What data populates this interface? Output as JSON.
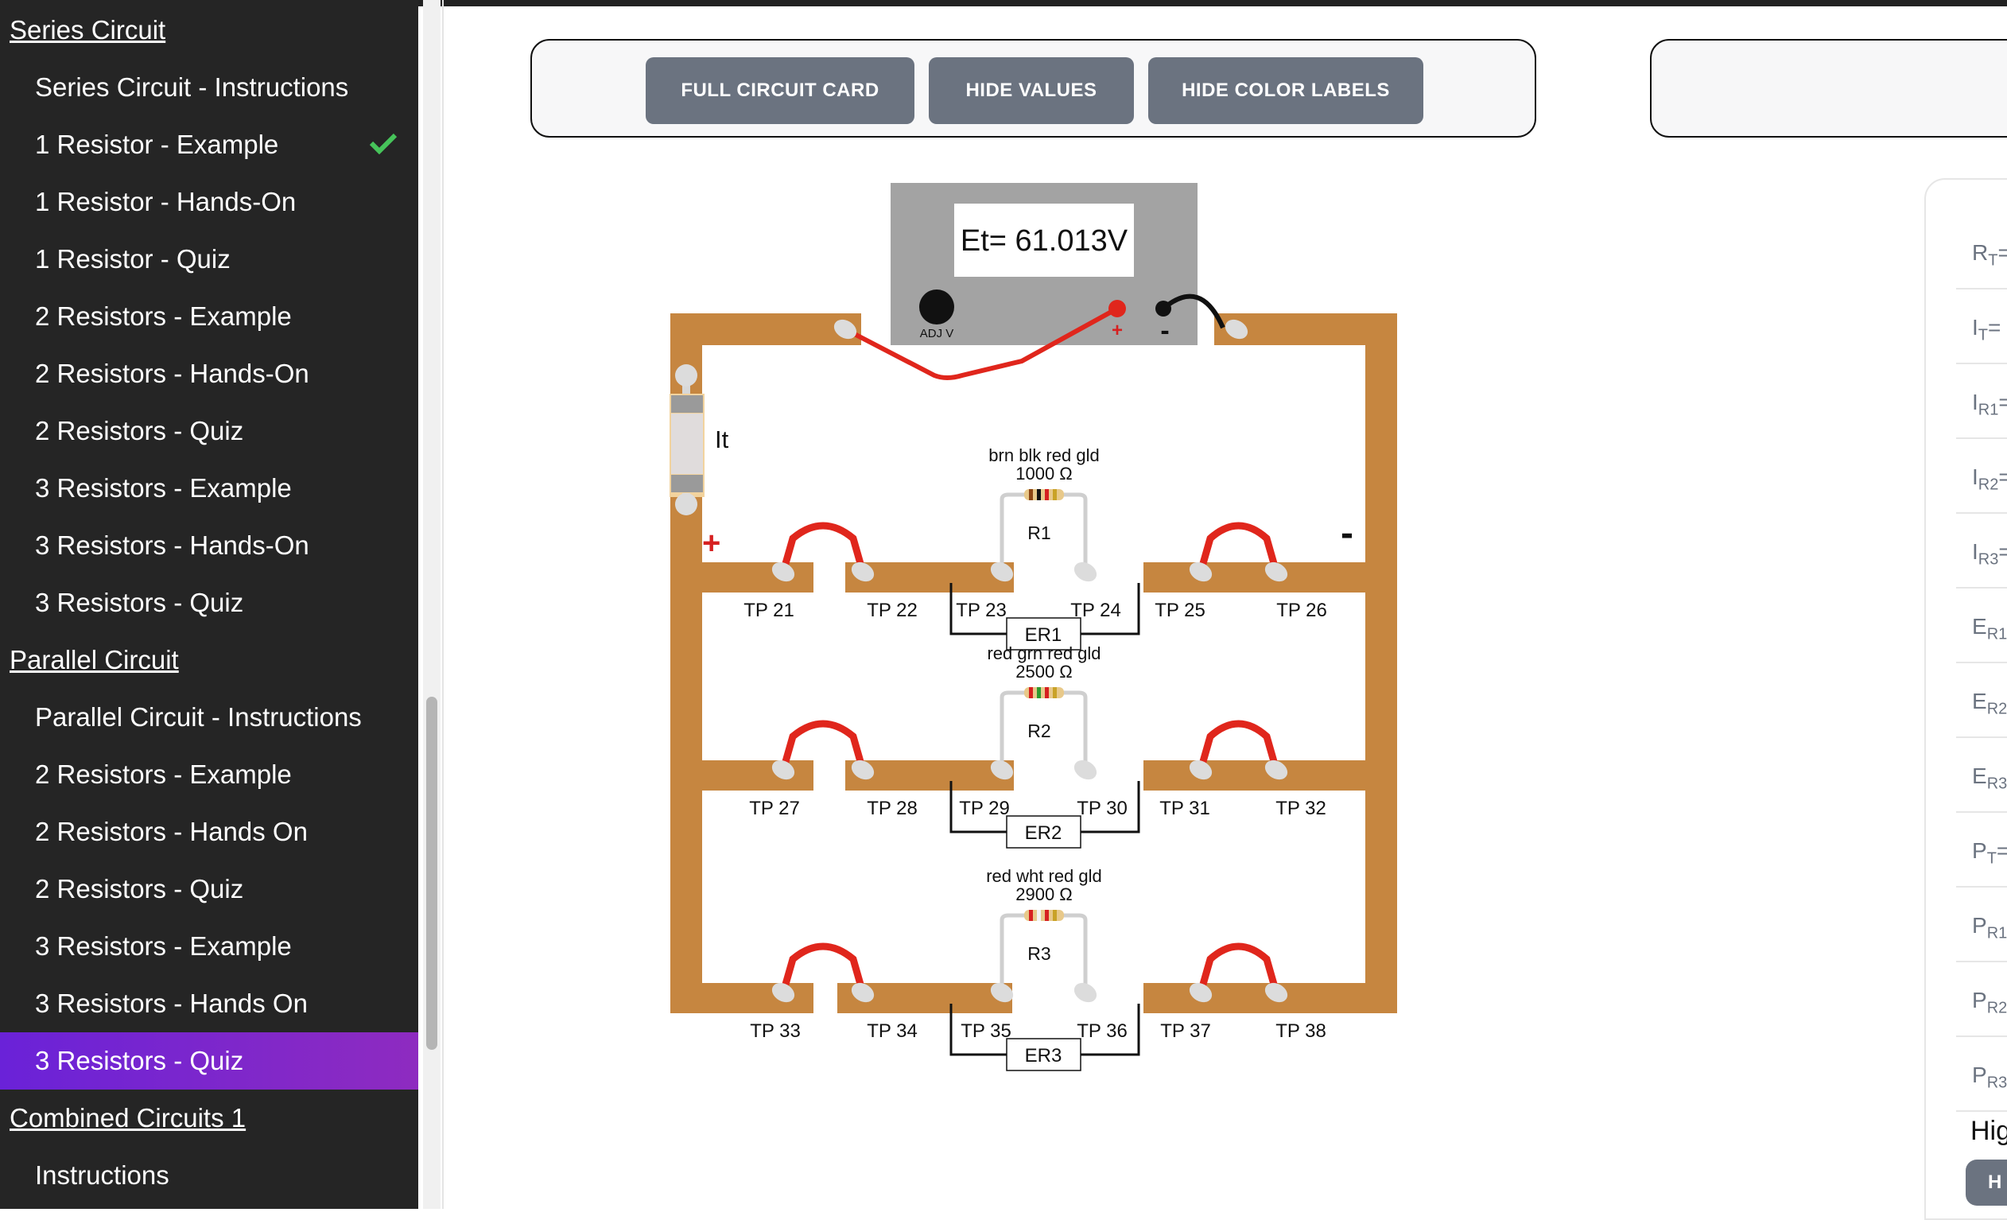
{
  "sidebar": {
    "rows": [
      {
        "type": "section",
        "label": "Series Circuit"
      },
      {
        "type": "item",
        "label": "Series Circuit - Instructions"
      },
      {
        "type": "item",
        "label": "1 Resistor - Example",
        "completed": true
      },
      {
        "type": "item",
        "label": "1 Resistor - Hands-On"
      },
      {
        "type": "item",
        "label": "1 Resistor - Quiz"
      },
      {
        "type": "item",
        "label": "2 Resistors - Example"
      },
      {
        "type": "item",
        "label": "2 Resistors - Hands-On"
      },
      {
        "type": "item",
        "label": "2 Resistors - Quiz"
      },
      {
        "type": "item",
        "label": "3 Resistors - Example"
      },
      {
        "type": "item",
        "label": "3 Resistors - Hands-On"
      },
      {
        "type": "item",
        "label": "3 Resistors - Quiz"
      },
      {
        "type": "section",
        "label": "Parallel Circuit"
      },
      {
        "type": "item",
        "label": "Parallel Circuit - Instructions"
      },
      {
        "type": "item",
        "label": "2 Resistors - Example"
      },
      {
        "type": "item",
        "label": "2 Resistors - Hands On"
      },
      {
        "type": "item",
        "label": "2 Resistors - Quiz"
      },
      {
        "type": "item",
        "label": "3 Resistors - Example"
      },
      {
        "type": "item",
        "label": "3 Resistors - Hands On"
      },
      {
        "type": "item",
        "label": "3 Resistors - Quiz",
        "active": true
      },
      {
        "type": "section",
        "label": "Combined Circuits 1"
      },
      {
        "type": "item",
        "label": "Instructions"
      }
    ]
  },
  "toolbar": {
    "full_circuit_card": "FULL CIRCUIT CARD",
    "hide_values": "HIDE VALUES",
    "hide_color_labels": "HIDE COLOR LABELS"
  },
  "supply": {
    "display": "Et= 61.013V",
    "adj_label": "ADJ V",
    "plus": "+",
    "minus": "-"
  },
  "meter_label": "It",
  "rail_plus": "+",
  "rail_minus": "-",
  "branches": [
    {
      "name": "R1",
      "colors": "brn blk red gld",
      "value": "1000 Ω",
      "er": "ER1",
      "band_colors": [
        "#8b4513",
        "#111111",
        "#d62020",
        "#c9a227"
      ],
      "tps": [
        "TP 21",
        "TP 22",
        "TP 23",
        "TP 24",
        "TP 25",
        "TP 26"
      ]
    },
    {
      "name": "R2",
      "colors": "red grn red gld",
      "value": "2500 Ω",
      "er": "ER2",
      "band_colors": [
        "#d62020",
        "#2e9a2e",
        "#d62020",
        "#c9a227"
      ],
      "tps": [
        "TP 27",
        "TP 28",
        "TP 29",
        "TP 30",
        "TP 31",
        "TP 32"
      ]
    },
    {
      "name": "R3",
      "colors": "red wht red gld",
      "value": "2900 Ω",
      "er": "ER3",
      "band_colors": [
        "#d62020",
        "#f4f4f4",
        "#d62020",
        "#c9a227"
      ],
      "tps": [
        "TP 33",
        "TP 34",
        "TP 35",
        "TP 36",
        "TP 37",
        "TP 38"
      ]
    }
  ],
  "results_panel": {
    "labels": [
      {
        "main": "R",
        "sub": "T",
        "suffix": "="
      },
      {
        "main": "I",
        "sub": "T",
        "suffix": "="
      },
      {
        "main": "I",
        "sub": "R1",
        "suffix": "="
      },
      {
        "main": "I",
        "sub": "R2",
        "suffix": "="
      },
      {
        "main": "I",
        "sub": "R3",
        "suffix": "="
      },
      {
        "main": "E",
        "sub": "R1",
        "suffix": "="
      },
      {
        "main": "E",
        "sub": "R2",
        "suffix": ""
      },
      {
        "main": "E",
        "sub": "R3",
        "suffix": ""
      },
      {
        "main": "P",
        "sub": "T",
        "suffix": "="
      },
      {
        "main": "P",
        "sub": "R1",
        "suffix": "="
      },
      {
        "main": "P",
        "sub": "R2",
        "suffix": ""
      },
      {
        "main": "P",
        "sub": "R3",
        "suffix": ""
      }
    ],
    "footer_text": "Hig",
    "footer_button": "H"
  },
  "colors": {
    "sidebar_bg": "#252525",
    "active_start": "#6a22d8",
    "active_end": "#8e2bc0",
    "button_gray": "#6b7380",
    "board_copper": "#c68640",
    "wire_red": "#e0261c",
    "check_green": "#46c35a"
  }
}
